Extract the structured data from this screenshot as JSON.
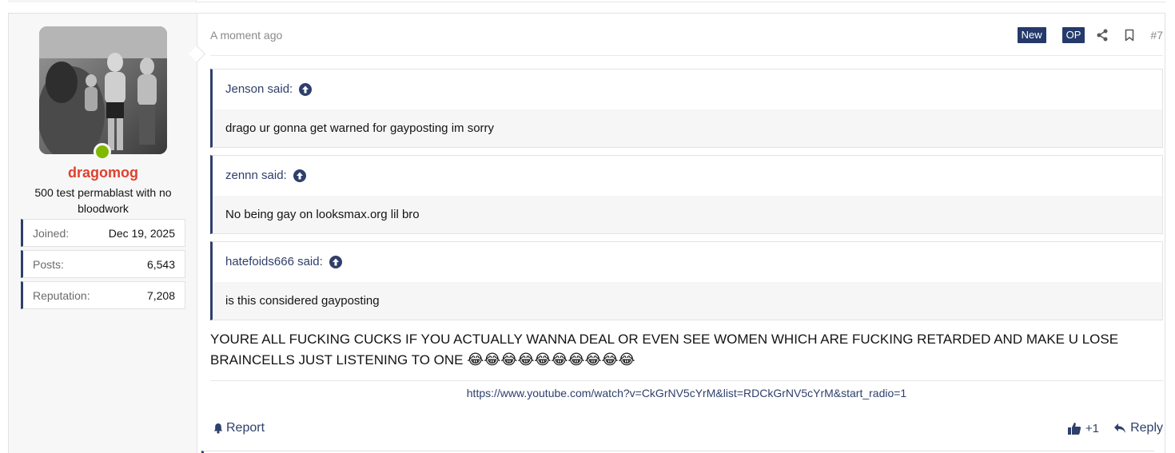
{
  "post": {
    "date": "A moment ago",
    "badge_new": "New",
    "badge_op": "OP",
    "number": "#7",
    "text": "YOURE ALL FUCKING CUCKS IF YOU ACTUALLY WANNA DEAL OR EVEN SEE WOMEN WHICH ARE FUCKING RETARDED AND MAKE U LOSE BRAINCELLS JUST LISTENING TO ONE",
    "emojis": "😂😂😂😂😂😂😂😂😂😂",
    "signature_link": "https://www.youtube.com/watch?v=CkGrNV5cYrM&list=RDCkGrNV5cYrM&start_radio=1"
  },
  "user": {
    "name": "dragomog",
    "title": "500 test permablast with no bloodwork",
    "online": true,
    "name_color": "#e0412e",
    "stats": [
      {
        "label": "Joined:",
        "value": "Dec 19, 2025"
      },
      {
        "label": "Posts:",
        "value": "6,543"
      },
      {
        "label": "Reputation:",
        "value": "7,208"
      }
    ]
  },
  "quotes": [
    {
      "author": "Jenson said:",
      "text": "drago ur gonna get warned for gayposting im sorry"
    },
    {
      "author": "zennn said:",
      "text": "No being gay on looksmax.org lil bro"
    },
    {
      "author": "hatefoids666 said:",
      "text": "is this considered gayposting"
    }
  ],
  "footer": {
    "report_label": "Report",
    "like_count": "+1",
    "reply_label": "Reply"
  },
  "colors": {
    "accent": "#2f3f6b",
    "online": "#7fba00"
  }
}
